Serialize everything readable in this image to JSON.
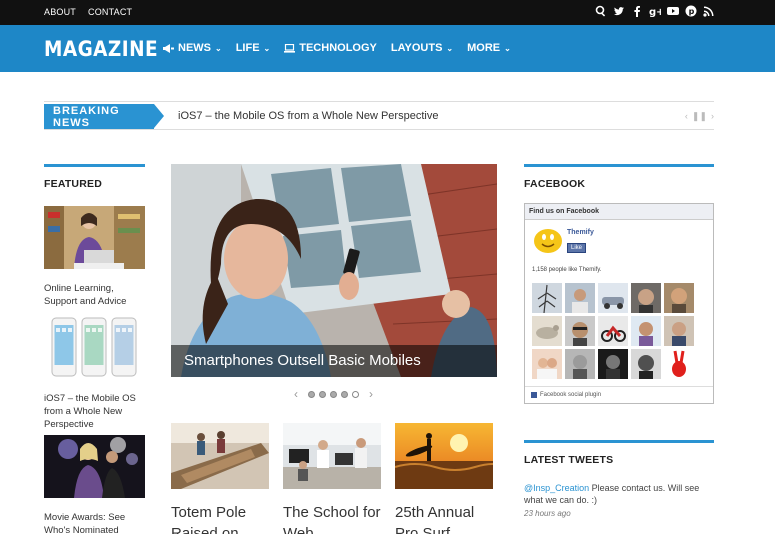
{
  "topbar": {
    "links": [
      "ABOUT",
      "CONTACT"
    ],
    "social_icons": [
      "search-icon",
      "twitter-icon",
      "facebook-icon",
      "google-plus-icon",
      "youtube-icon",
      "pinterest-icon",
      "rss-icon"
    ]
  },
  "header": {
    "logo": "MAGAZINE",
    "nav": [
      {
        "label": "NEWS",
        "icon": "megaphone-icon",
        "has_menu": true
      },
      {
        "label": "LIFE",
        "icon": "",
        "has_menu": true
      },
      {
        "label": "TECHNOLOGY",
        "icon": "laptop-icon",
        "has_menu": false
      },
      {
        "label": "LAYOUTS",
        "icon": "",
        "has_menu": true
      },
      {
        "label": "MORE",
        "icon": "",
        "has_menu": true
      }
    ]
  },
  "breaking": {
    "label": "BREAKING NEWS",
    "headline": "iOS7 – the Mobile OS from a Whole New Perspective"
  },
  "featured": {
    "heading": "FEATURED",
    "items": [
      {
        "caption": "Online Learning, Support and Advice"
      },
      {
        "caption": "iOS7 – the Mobile OS from a Whole New Perspective"
      },
      {
        "caption": "Movie Awards: See Who's Nominated"
      }
    ]
  },
  "slider": {
    "caption": "Smartphones Outsell Basic Mobiles",
    "slide_count": 5,
    "active_slide": 5
  },
  "posts": [
    {
      "title": "Totem Pole Raised on"
    },
    {
      "title": "The School for Web"
    },
    {
      "title": "25th Annual Pro Surf"
    }
  ],
  "facebook": {
    "heading": "FACEBOOK",
    "find_us": "Find us on Facebook",
    "page_name": "Themify",
    "like_label": "Like",
    "count_text": "1,158 people like Themify.",
    "plugin_label": "Facebook social plugin"
  },
  "tweets": {
    "heading": "LATEST TWEETS",
    "items": [
      {
        "handle": "@Insp_Creation",
        "text": " Please contact us. Will see what we can do. :)",
        "time": "23 hours ago"
      }
    ]
  },
  "colors": {
    "accent": "#1e87c7",
    "topbar": "#111111"
  }
}
